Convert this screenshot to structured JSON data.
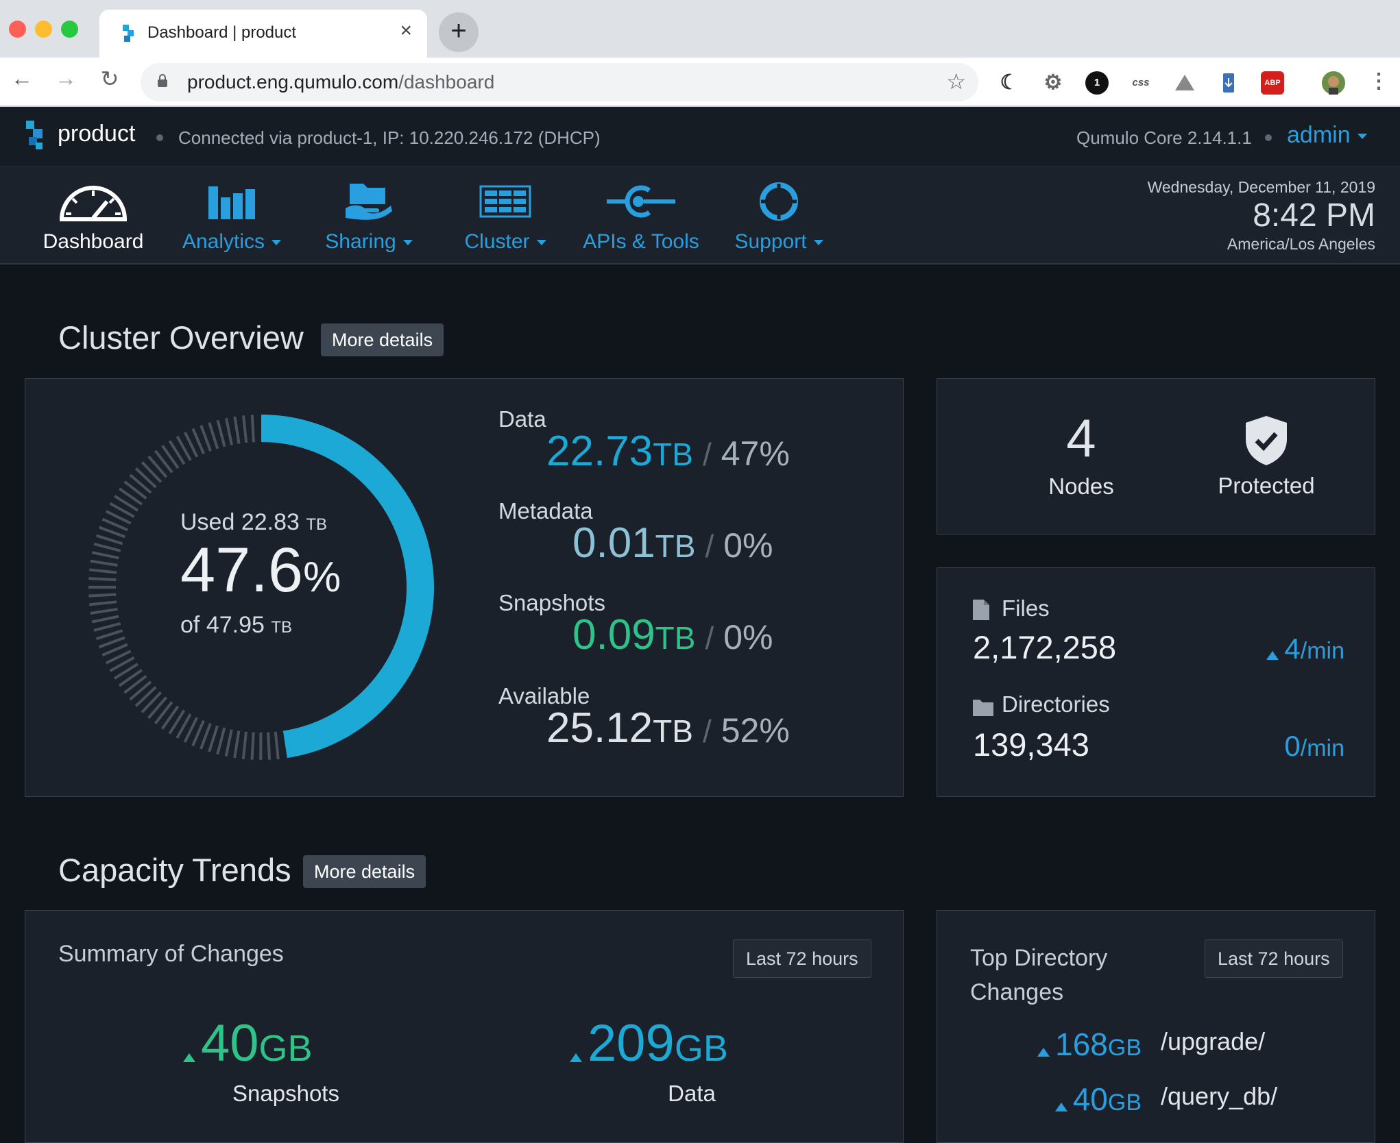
{
  "browser": {
    "tab_title": "Dashboard | product",
    "url_host": "product.eng.qumulo.com",
    "url_path": "/dashboard",
    "ext_onepassword": "1",
    "ext_css": "css",
    "ext_abp": "ABP"
  },
  "header": {
    "product": "product",
    "connection": "Connected via product-1, IP: 10.220.246.172 (DHCP)",
    "version": "Qumulo Core 2.14.1.1",
    "user": "admin"
  },
  "nav": {
    "items": [
      {
        "label": "Dashboard"
      },
      {
        "label": "Analytics"
      },
      {
        "label": "Sharing"
      },
      {
        "label": "Cluster"
      },
      {
        "label": "APIs & Tools"
      },
      {
        "label": "Support"
      }
    ],
    "date": "Wednesday, December 11, 2019",
    "time": "8:42 PM",
    "timezone": "America/Los Angeles"
  },
  "overview": {
    "title": "Cluster Overview",
    "more": "More details",
    "used_label": "Used",
    "used_value": "22.83",
    "used_unit": "TB",
    "percent": "47.6",
    "percent_sign": "%",
    "of_label": "of",
    "total_value": "47.95",
    "total_unit": "TB",
    "used_fraction": 0.476,
    "stats": [
      {
        "label": "Data",
        "value": "22.73",
        "unit": "TB",
        "sep": "/",
        "pct": "47%",
        "color": "#1da9d6"
      },
      {
        "label": "Metadata",
        "value": "0.01",
        "unit": "TB",
        "sep": "/",
        "pct": "0%",
        "color": "#8cc2d6"
      },
      {
        "label": "Snapshots",
        "value": "0.09",
        "unit": "TB",
        "sep": "/",
        "pct": "0%",
        "color": "#2ec489"
      },
      {
        "label": "Available",
        "value": "25.12",
        "unit": "TB",
        "sep": "/",
        "pct": "52%",
        "color": "#dfe3e8"
      }
    ],
    "nodes_value": "4",
    "nodes_label": "Nodes",
    "protected_label": "Protected",
    "files_label": "Files",
    "files_value": "2,172,258",
    "files_rate": "4",
    "files_rate_unit": "/min",
    "dirs_label": "Directories",
    "dirs_value": "139,343",
    "dirs_rate": "0",
    "dirs_rate_unit": "/min"
  },
  "trends": {
    "title": "Capacity Trends",
    "more": "More details",
    "summary_title": "Summary of Changes",
    "summary_range": "Last 72 hours",
    "snap_value": "40",
    "snap_unit": "GB",
    "snap_label": "Snapshots",
    "data_value": "209",
    "data_unit": "GB",
    "data_label": "Data",
    "top_title_1": "Top Directory",
    "top_title_2": "Changes",
    "top_range": "Last 72 hours",
    "top": [
      {
        "value": "168",
        "unit": "GB",
        "path": "/upgrade/"
      },
      {
        "value": "40",
        "unit": "GB",
        "path": "/query_db/"
      }
    ]
  },
  "colors": {
    "accent": "#2a9fe0",
    "data": "#1da9d6",
    "snapshots": "#2ec489"
  }
}
